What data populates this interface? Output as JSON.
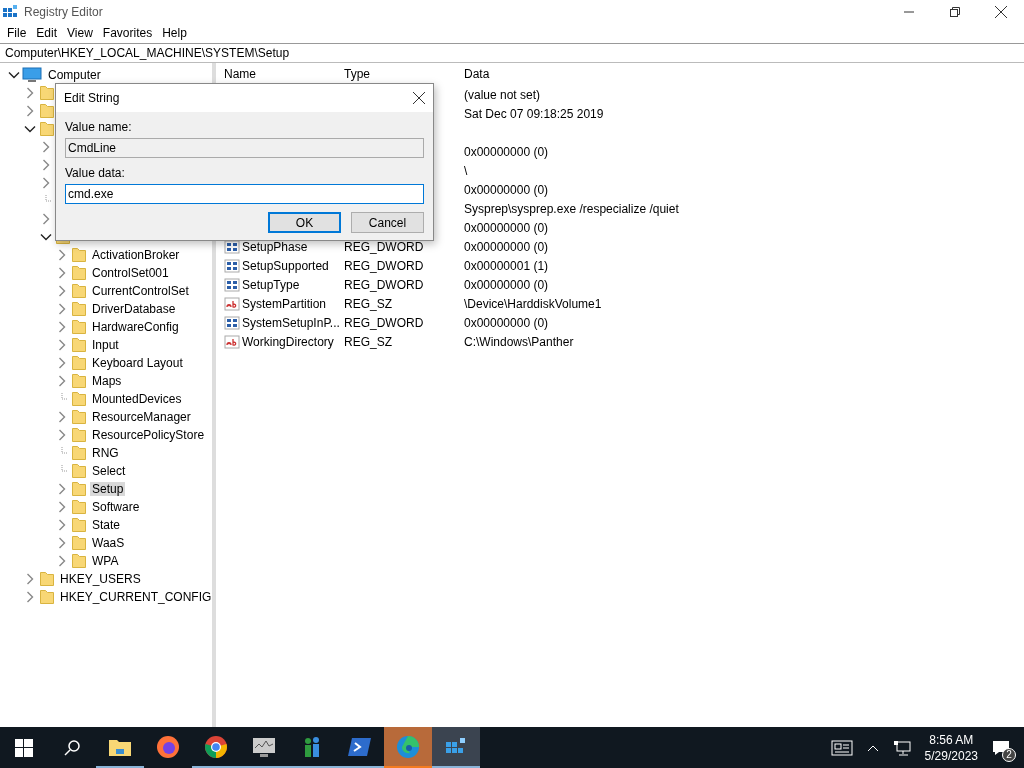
{
  "window": {
    "title": "Registry Editor"
  },
  "menu": [
    "File",
    "Edit",
    "View",
    "Favorites",
    "Help"
  ],
  "address": "Computer\\HKEY_LOCAL_MACHINE\\SYSTEM\\Setup",
  "tree": {
    "label": "Computer",
    "expanded": true,
    "selected": false,
    "children": [
      {
        "expanded": false
      },
      {
        "expanded": false
      },
      {
        "expanded": true,
        "children": [
          {
            "expanded": false
          },
          {
            "expanded": false
          },
          {
            "expanded": false
          },
          {
            "kind": "leaf"
          },
          {
            "expanded": false
          },
          {
            "expanded": true,
            "children": [
              {
                "label": "ActivationBroker",
                "expanded": false,
                "selected": false
              },
              {
                "label": "ControlSet001",
                "expanded": false,
                "selected": false
              },
              {
                "label": "CurrentControlSet",
                "expanded": false,
                "selected": false
              },
              {
                "label": "DriverDatabase",
                "expanded": false,
                "selected": false
              },
              {
                "label": "HardwareConfig",
                "expanded": false,
                "selected": false
              },
              {
                "label": "Input",
                "expanded": false,
                "selected": false
              },
              {
                "label": "Keyboard Layout",
                "expanded": false,
                "selected": false
              },
              {
                "label": "Maps",
                "expanded": false,
                "selected": false
              },
              {
                "label": "MountedDevices",
                "kind": "leaf",
                "selected": false
              },
              {
                "label": "ResourceManager",
                "expanded": false,
                "selected": false
              },
              {
                "label": "ResourcePolicyStore",
                "expanded": false,
                "selected": false
              },
              {
                "label": "RNG",
                "kind": "leaf",
                "selected": false
              },
              {
                "label": "Select",
                "kind": "leaf",
                "selected": false
              },
              {
                "label": "Setup",
                "expanded": false,
                "selected": true
              },
              {
                "label": "Software",
                "expanded": false,
                "selected": false
              },
              {
                "label": "State",
                "expanded": false,
                "selected": false
              },
              {
                "label": "WaaS",
                "expanded": false,
                "selected": false
              },
              {
                "label": "WPA",
                "expanded": false,
                "selected": false
              }
            ]
          }
        ]
      },
      {
        "label": "HKEY_USERS",
        "expanded": false,
        "selected": false
      },
      {
        "label": "HKEY_CURRENT_CONFIG",
        "expanded": false,
        "selected": false
      }
    ]
  },
  "columns": [
    "Name",
    "Type",
    "Data"
  ],
  "values": [
    {
      "data": "(value not set)"
    },
    {
      "data": "Sat Dec 07 09:18:25 2019"
    },
    {
      "kind": "blank"
    },
    {
      "data": "0x00000000 (0)"
    },
    {
      "data": "\\"
    },
    {
      "data": "0x00000000 (0)"
    },
    {
      "data": "Sysprep\\sysprep.exe /respecialize /quiet"
    },
    {
      "data": "0x00000000 (0)"
    },
    {
      "name": "SetupPhase",
      "kind": "dword",
      "type": "REG_DWORD",
      "data": "0x00000000 (0)"
    },
    {
      "name": "SetupSupported",
      "kind": "dword",
      "type": "REG_DWORD",
      "data": "0x00000001 (1)"
    },
    {
      "name": "SetupType",
      "kind": "dword",
      "type": "REG_DWORD",
      "data": "0x00000000 (0)"
    },
    {
      "name": "SystemPartition",
      "kind": "string",
      "type": "REG_SZ",
      "data": "\\Device\\HarddiskVolume1"
    },
    {
      "name": "SystemSetupInP...",
      "kind": "dword",
      "type": "REG_DWORD",
      "data": "0x00000000 (0)"
    },
    {
      "name": "WorkingDirectory",
      "kind": "string",
      "type": "REG_SZ",
      "data": "C:\\Windows\\Panther"
    }
  ],
  "dialog": {
    "title": "Edit String",
    "name_label": "Value name:",
    "name_value": "CmdLine",
    "data_label": "Value data:",
    "data_value": "cmd.exe",
    "buttons": [
      {
        "label": "OK",
        "selected": true
      },
      {
        "label": "Cancel",
        "selected": false
      }
    ]
  },
  "taskbar": {
    "apps": [
      {
        "kind": "folder",
        "running": true,
        "active": false
      },
      {
        "kind": "firefox",
        "running": false,
        "active": false
      },
      {
        "kind": "chrome",
        "running": true,
        "active": false
      },
      {
        "kind": "monitor",
        "running": true,
        "active": false
      },
      {
        "kind": "people",
        "running": true,
        "active": false
      },
      {
        "kind": "shell",
        "running": true,
        "active": false
      },
      {
        "kind": "edge",
        "running": true,
        "active": true
      },
      {
        "kind": "registry",
        "running": true,
        "active": false
      }
    ],
    "time": "8:56 AM",
    "date": "5/29/2023",
    "notifications": "2"
  }
}
